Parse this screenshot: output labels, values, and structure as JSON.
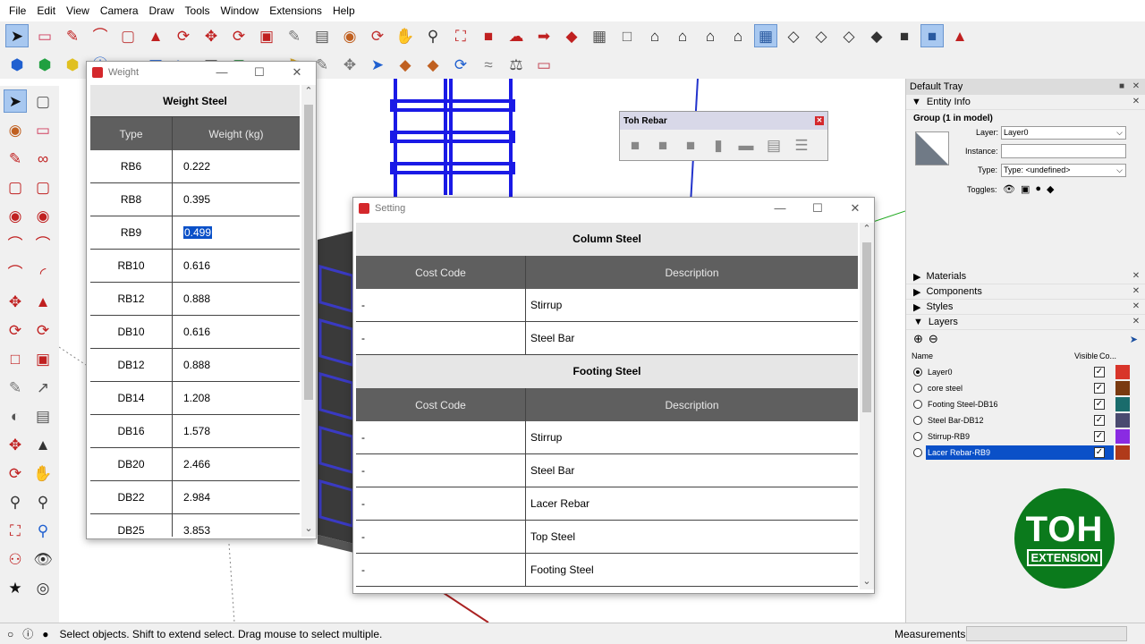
{
  "menubar": {
    "items": [
      "File",
      "Edit",
      "View",
      "Camera",
      "Draw",
      "Tools",
      "Window",
      "Extensions",
      "Help"
    ]
  },
  "toolbar_icons_row1": [
    "select-icon",
    "eraser-icon",
    "pencil-icon",
    "arc-icon",
    "rectangle-icon",
    "pushpull-icon",
    "followme-icon",
    "move-icon",
    "rotate-icon",
    "offset-icon",
    "tape-icon",
    "text-icon",
    "paint-icon",
    "orbit-icon",
    "pan-icon",
    "zoom-icon",
    "zoom-extents-icon",
    "warehouse-icon",
    "share-icon",
    "send-icon",
    "ruby-icon",
    "component-icon",
    "box-icon",
    "house-icon",
    "home-icon",
    "house2-icon",
    "house3-icon",
    "xray-icon",
    "back-edges-icon",
    "wireframe-icon",
    "hidden-line-icon",
    "shaded-icon",
    "textured-icon",
    "monochrome-icon",
    "ruby-console-icon"
  ],
  "toolbar_icons_row2": [
    "iso-icon",
    "top-icon",
    "front-icon",
    "d-icon",
    "house-red-icon",
    "model-info-icon",
    "play-icon",
    "section-icon",
    "photo-icon",
    "layer-icon",
    "tag-icon",
    "pen-icon",
    "axis-icon",
    "scene-icon",
    "layout-icon",
    "paint2-icon",
    "flip-icon",
    "measure-icon",
    "scale-icon",
    "eraser2-icon"
  ],
  "weight_window": {
    "title": "Weight",
    "header": "Weight Steel",
    "col_type": "Type",
    "col_weight": "Weight (kg)",
    "rows": [
      {
        "type": "RB6",
        "weight": "0.222"
      },
      {
        "type": "RB8",
        "weight": "0.395"
      },
      {
        "type": "RB9",
        "weight": "0.499"
      },
      {
        "type": "RB10",
        "weight": "0.616"
      },
      {
        "type": "RB12",
        "weight": "0.888"
      },
      {
        "type": "DB10",
        "weight": "0.616"
      },
      {
        "type": "DB12",
        "weight": "0.888"
      },
      {
        "type": "DB14",
        "weight": "1.208"
      },
      {
        "type": "DB16",
        "weight": "1.578"
      },
      {
        "type": "DB20",
        "weight": "2.466"
      },
      {
        "type": "DB22",
        "weight": "2.984"
      },
      {
        "type": "DB25",
        "weight": "3.853"
      }
    ],
    "selected_row": 2
  },
  "setting_window": {
    "title": "Setting",
    "column_header": "Column Steel",
    "footing_header": "Footing Steel",
    "col_code": "Cost Code",
    "col_desc": "Description",
    "column_rows": [
      {
        "code": "-",
        "desc": "Stirrup"
      },
      {
        "code": "-",
        "desc": "Steel Bar"
      }
    ],
    "footing_rows": [
      {
        "code": "-",
        "desc": "Stirrup"
      },
      {
        "code": "-",
        "desc": "Steel Bar"
      },
      {
        "code": "-",
        "desc": "Lacer Rebar"
      },
      {
        "code": "-",
        "desc": "Top Steel"
      },
      {
        "code": "-",
        "desc": "Footing Steel"
      }
    ]
  },
  "toh_rebar": {
    "title": "Toh Rebar"
  },
  "tray": {
    "title": "Default Tray",
    "entity_info": "Entity Info",
    "group_label": "Group (1 in model)",
    "layer_label": "Layer:",
    "layer_value": "Layer0",
    "instance_label": "Instance:",
    "type_label": "Type:",
    "type_value": "Type: <undefined>",
    "toggles_label": "Toggles:",
    "sections": [
      "Materials",
      "Components",
      "Styles",
      "Layers"
    ],
    "layers_col_name": "Name",
    "layers_col_visible": "Visible",
    "layers_col_color": "Co...",
    "layers": [
      {
        "name": "Layer0",
        "active": true,
        "color": "#d8352a",
        "selected": false
      },
      {
        "name": "core steel",
        "active": false,
        "color": "#7a3a10",
        "selected": false
      },
      {
        "name": "Footing Steel-DB16",
        "active": false,
        "color": "#1a6c6c",
        "selected": false
      },
      {
        "name": "Steel Bar-DB12",
        "active": false,
        "color": "#4a4a70",
        "selected": false
      },
      {
        "name": "Stirrup-RB9",
        "active": false,
        "color": "#8a2be2",
        "selected": false
      },
      {
        "name": "Lacer Rebar-RB9",
        "active": false,
        "color": "#b03a1a",
        "selected": true
      }
    ]
  },
  "logo": {
    "line1": "TOH",
    "line2": "EXTENSION",
    "color": "#0b7a1c"
  },
  "status": {
    "hint": "Select objects. Shift to extend select. Drag mouse to select multiple.",
    "measurements_label": "Measurements"
  }
}
